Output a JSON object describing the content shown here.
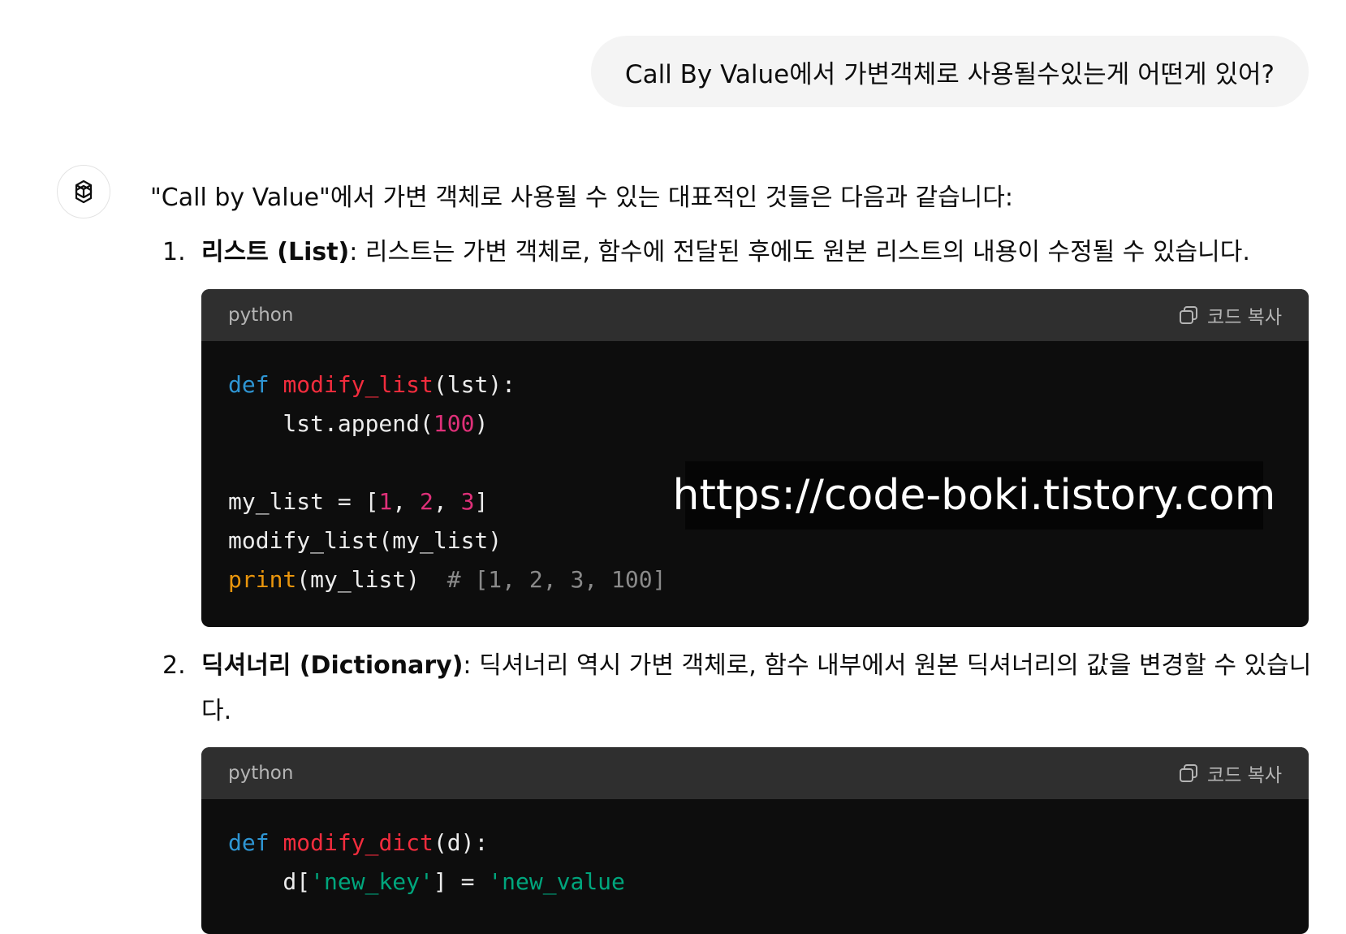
{
  "user_message": "Call By Value에서 가변객체로 사용될수있는게 어떤게 있어?",
  "assistant": {
    "intro": "\"Call by Value\"에서 가변 객체로 사용될 수 있는 대표적인 것들은 다음과 같습니다:",
    "items": [
      {
        "number": "1.",
        "title": "리스트 (List)",
        "text": ": 리스트는 가변 객체로, 함수에 전달된 후에도 원본 리스트의 내용이 수정될 수 있습니다.",
        "code": {
          "language": "python",
          "copy_label": "코드 복사",
          "lines": [
            "def modify_list(lst):",
            "    lst.append(100)",
            "",
            "my_list = [1, 2, 3]",
            "modify_list(my_list)",
            "print(my_list)  # [1, 2, 3, 100]"
          ]
        }
      },
      {
        "number": "2.",
        "title": "딕셔너리 (Dictionary)",
        "text": ": 딕셔너리 역시 가변 객체로, 함수 내부에서 원본 딕셔너리의 값을 변경할 수 있습니",
        "text_cont": "다.",
        "code": {
          "language": "python",
          "copy_label": "코드 복사",
          "lines": [
            "def modify_dict(d):",
            "    d['new_key'] = 'new_value"
          ]
        }
      }
    ]
  },
  "watermark": "https://code-boki.tistory.com",
  "colors": {
    "keyword": "#2e95d3",
    "function": "#f22c3d",
    "number": "#df3079",
    "builtin": "#e9950c",
    "comment": "#8a8a8a",
    "string": "#00a67d"
  }
}
